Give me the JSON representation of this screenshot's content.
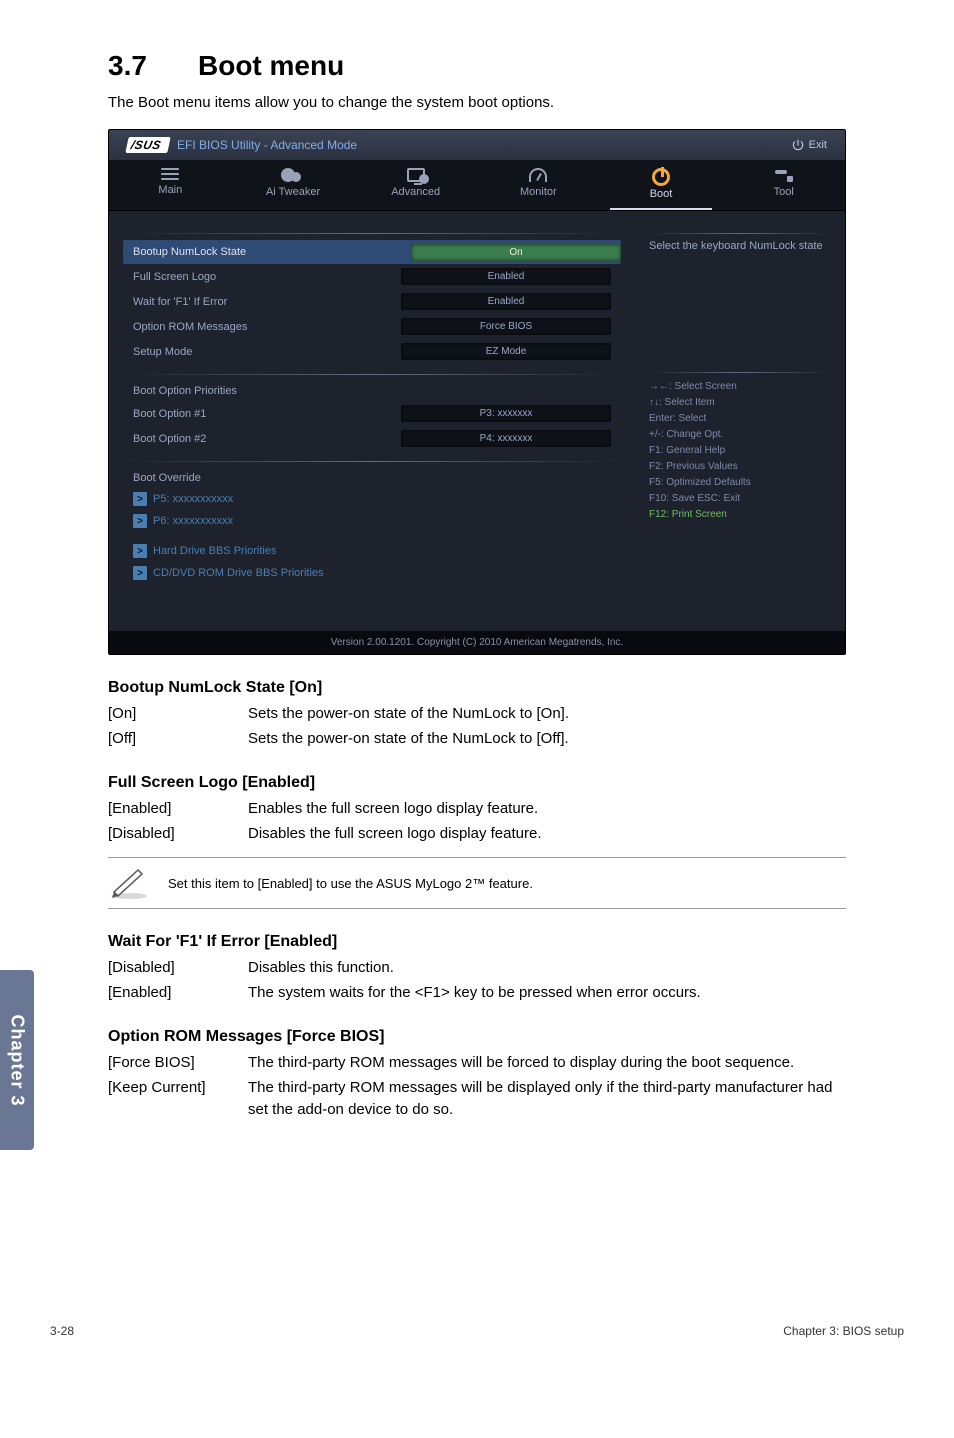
{
  "heading_num": "3.7",
  "heading_title": "Boot menu",
  "intro": "The Boot menu items allow you to change the system boot options.",
  "bios": {
    "brand": "/SUS",
    "title": "EFI BIOS Utility - Advanced Mode",
    "exit": "Exit",
    "tabs": {
      "main": "Main",
      "ai": "Ai Tweaker",
      "advanced": "Advanced",
      "monitor": "Monitor",
      "boot": "Boot",
      "tool": "Tool"
    },
    "rows": {
      "numlock": {
        "label": "Bootup NumLock State",
        "val": "On"
      },
      "fullscreen": {
        "label": "Full Screen Logo",
        "val": "Enabled"
      },
      "waitf1": {
        "label": "Wait for 'F1' If Error",
        "val": "Enabled"
      },
      "optionrom": {
        "label": "Option ROM Messages",
        "val": "Force BIOS"
      },
      "setupmode": {
        "label": "Setup Mode",
        "val": "EZ Mode"
      }
    },
    "bootpri": {
      "header": "Boot Option Priorities",
      "opt1": {
        "label": "Boot Option #1",
        "val": "P3: xxxxxxx"
      },
      "opt2": {
        "label": "Boot Option #2",
        "val": "P4: xxxxxxx"
      }
    },
    "override": {
      "header": "Boot Override",
      "p5": "P5: xxxxxxxxxxx",
      "p6": "P6: xxxxxxxxxxx",
      "hard": "Hard Drive BBS Priorities",
      "cd": "CD/DVD ROM Drive BBS Priorities"
    },
    "help": "Select the keyboard NumLock state",
    "keys": {
      "k1": "→←: Select Screen",
      "k2": "↑↓: Select Item",
      "k3": "Enter: Select",
      "k4": "+/-: Change Opt.",
      "k5": "F1: General Help",
      "k6": "F2: Previous Values",
      "k7": "F5: Optimized Defaults",
      "k8": "F10: Save   ESC: Exit",
      "k9": "F12: Print Screen"
    },
    "footer": "Version 2.00.1201.  Copyright (C) 2010 American Megatrends, Inc."
  },
  "sections": {
    "numlock": {
      "title": "Bootup NumLock State [On]",
      "on_k": "[On]",
      "on_v": "Sets the power-on state of the NumLock to [On].",
      "off_k": "[Off]",
      "off_v": "Sets the power-on state of the NumLock to [Off]."
    },
    "fullscreen": {
      "title": "Full Screen Logo [Enabled]",
      "en_k": "[Enabled]",
      "en_v": "Enables the full screen logo display feature.",
      "dis_k": "[Disabled]",
      "dis_v": "Disables the full screen logo display feature.",
      "note": "Set this item to [Enabled] to use the ASUS MyLogo 2™ feature."
    },
    "waitf1": {
      "title": "Wait For 'F1' If Error [Enabled]",
      "dis_k": "[Disabled]",
      "dis_v": "Disables this function.",
      "en_k": "[Enabled]",
      "en_v": "The system waits for the <F1> key to be pressed when error occurs."
    },
    "optionrom": {
      "title": "Option ROM Messages [Force BIOS]",
      "fb_k": "[Force BIOS]",
      "fb_v": "The third-party ROM messages will be forced to display during the boot sequence.",
      "kc_k": "[Keep Current]",
      "kc_v": "The third-party ROM messages will be displayed only if the third-party manufacturer had set the add-on device to do so."
    }
  },
  "chapter_tab": "Chapter 3",
  "footer": {
    "left": "3-28",
    "right": "Chapter 3: BIOS setup"
  }
}
